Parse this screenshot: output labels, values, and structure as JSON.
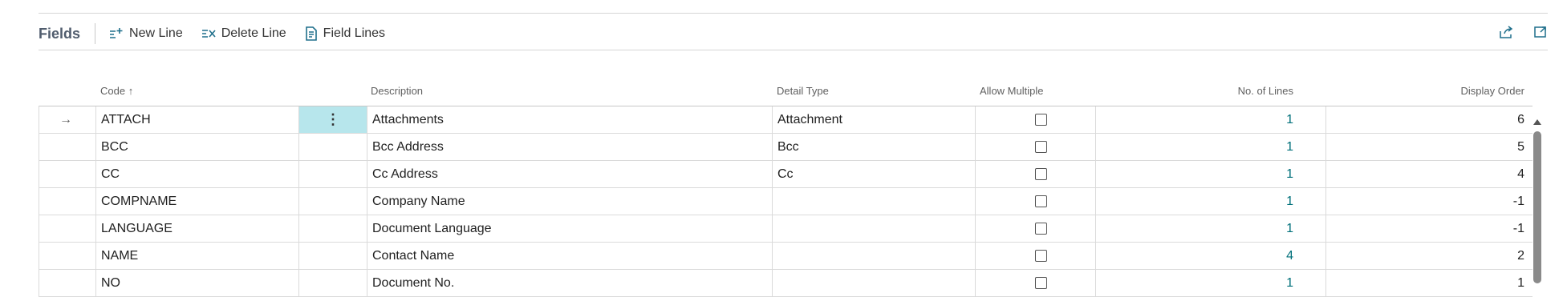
{
  "toolbar": {
    "title": "Fields",
    "new_line": "New Line",
    "delete_line": "Delete Line",
    "field_lines": "Field Lines",
    "share_icon": "share-icon",
    "expand_icon": "expand-icon"
  },
  "columns": {
    "code": "Code",
    "sort_indicator": "↑",
    "description": "Description",
    "detail_type": "Detail Type",
    "allow_multiple": "Allow Multiple",
    "no_of_lines": "No. of Lines",
    "display_order": "Display Order"
  },
  "row_actions": {
    "selected_marker": "→",
    "more": "⋮"
  },
  "rows": [
    {
      "code": "ATTACH",
      "description": "Attachments",
      "detail_type": "Attachment",
      "allow_multiple": false,
      "no_of_lines": "1",
      "display_order": "6"
    },
    {
      "code": "BCC",
      "description": "Bcc Address",
      "detail_type": "Bcc",
      "allow_multiple": false,
      "no_of_lines": "1",
      "display_order": "5"
    },
    {
      "code": "CC",
      "description": "Cc Address",
      "detail_type": "Cc",
      "allow_multiple": false,
      "no_of_lines": "1",
      "display_order": "4"
    },
    {
      "code": "COMPNAME",
      "description": "Company Name",
      "detail_type": "",
      "allow_multiple": false,
      "no_of_lines": "1",
      "display_order": "-1"
    },
    {
      "code": "LANGUAGE",
      "description": "Document Language",
      "detail_type": "",
      "allow_multiple": false,
      "no_of_lines": "1",
      "display_order": "-1"
    },
    {
      "code": "NAME",
      "description": "Contact Name",
      "detail_type": "",
      "allow_multiple": false,
      "no_of_lines": "4",
      "display_order": "2"
    },
    {
      "code": "NO",
      "description": "Document No.",
      "detail_type": "",
      "allow_multiple": false,
      "no_of_lines": "1",
      "display_order": "1"
    }
  ]
}
